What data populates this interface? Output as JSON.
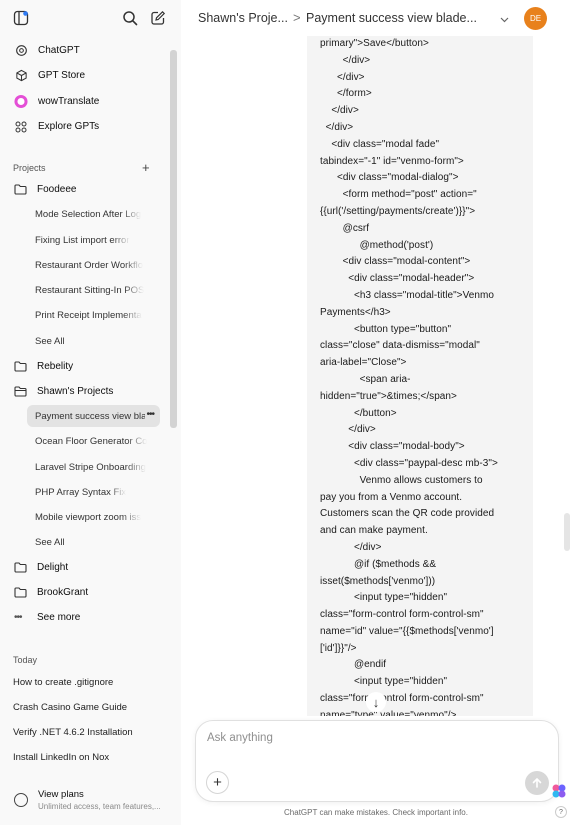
{
  "sidebar": {
    "top_icons": [
      "sidebar-toggle-icon",
      "search-icon",
      "new-chat-icon"
    ],
    "nav": [
      {
        "label": "ChatGPT",
        "icon": "openai-logo-icon"
      },
      {
        "label": "GPT Store",
        "icon": "cube-icon"
      },
      {
        "label": "wowTranslate",
        "icon": "wowtranslate-avatar-icon"
      },
      {
        "label": "Explore GPTs",
        "icon": "grid-icon"
      }
    ],
    "projects_label": "Projects",
    "projects": [
      {
        "name": "Foodeee",
        "chats": [
          "Mode Selection After Log",
          "Fixing List import error",
          "Restaurant Order Workflo",
          "Restaurant Sitting-In POS",
          "Print Receipt Implementa",
          "See All"
        ]
      },
      {
        "name": "Rebelity",
        "chats": []
      },
      {
        "name": "Shawn's Projects",
        "chats": [
          "Payment success view bla",
          "Ocean Floor Generator Co",
          "Laravel Stripe Onboarding",
          "PHP Array Syntax Fix",
          "Mobile viewport zoom iss",
          "See All"
        ]
      },
      {
        "name": "Delight",
        "chats": []
      },
      {
        "name": "BrookGrant",
        "chats": []
      }
    ],
    "see_more": "See more",
    "today_label": "Today",
    "today": [
      "How to create .gitignore",
      "Crash Casino Game Guide",
      "Verify .NET 4.6.2 Installation",
      "Install LinkedIn on Nox"
    ],
    "view_plans": {
      "title": "View plans",
      "subtitle": "Unlimited access, team features,..."
    }
  },
  "header": {
    "project": "Shawn's Proje...",
    "separator": ">",
    "chat_title": "Payment success view blade...",
    "avatar_initials": "DE",
    "avatar_color": "#e8811c"
  },
  "code_lines": [
    "primary\">Save</button>",
    "        </div>",
    "      </div>",
    "      </form>",
    "    </div>",
    "  </div>",
    "    <div class=\"modal fade\"",
    "tabindex=\"-1\" id=\"venmo-form\">",
    "      <div class=\"modal-dialog\">",
    "        <form method=\"post\" action=\"",
    "{{url('/setting/payments/create')}}\">",
    "        @csrf",
    "              @method('post')",
    "        <div class=\"modal-content\">",
    "          <div class=\"modal-header\">",
    "            <h3 class=\"modal-title\">Venmo",
    "Payments</h3>",
    "            <button type=\"button\"",
    "class=\"close\" data-dismiss=\"modal\"",
    "aria-label=\"Close\">",
    "              <span aria-",
    "hidden=\"true\">&times;</span>",
    "            </button>",
    "          </div>",
    "          <div class=\"modal-body\">",
    "            <div class=\"paypal-desc mb-3\">",
    "              Venmo allows customers to",
    "pay you from a Venmo account.",
    "Customers scan the QR code provided",
    "and can make payment.",
    "            </div>",
    "            @if ($methods &&",
    "isset($methods['venmo']))",
    "            <input type=\"hidden\"",
    "class=\"form-control form-control-sm\"",
    "name=\"id\" value=\"{{$methods['venmo']",
    "['id']}}\"/>",
    "            @endif",
    "            <input type=\"hidden\"",
    "class=\"form-control form-control-sm\"",
    "name=\"type\" value=\"venmo\"/>"
  ],
  "composer": {
    "placeholder": "Ask anything",
    "add_label": "+",
    "scroll_down": "↓"
  },
  "footer_note": "ChatGPT can make mistakes. Check important info.",
  "help_label": "?"
}
